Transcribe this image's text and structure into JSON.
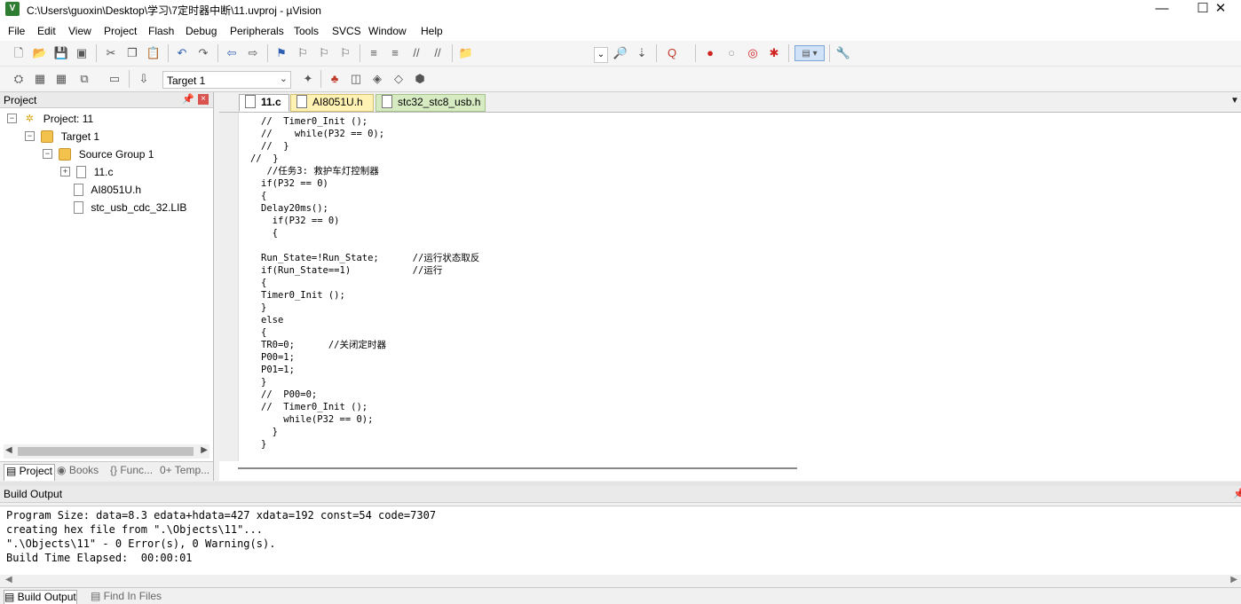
{
  "window": {
    "title": "C:\\Users\\guoxin\\Desktop\\学习\\7定时器中断\\11.uvproj - µVision",
    "controls": {
      "minimize": "—",
      "maximize": "☐",
      "close": "✕"
    }
  },
  "menu": [
    "File",
    "Edit",
    "View",
    "Project",
    "Flash",
    "Debug",
    "Peripherals",
    "Tools",
    "SVCS",
    "Window",
    "Help"
  ],
  "toolbar": {
    "target_value": "Target 1",
    "icons": [
      "new-file",
      "open-file",
      "save",
      "save-all",
      "cut",
      "copy",
      "paste",
      "undo",
      "redo",
      "navigate-back",
      "navigate-forward",
      "bookmark",
      "prev-bookmark",
      "next-bookmark",
      "clear-bookmarks",
      "indent",
      "unindent",
      "comment",
      "uncomment",
      "find-in-files",
      "find",
      "debug-start",
      "breakpoint",
      "disable-breakpoint",
      "kill-breakpoints",
      "window-layout",
      "configure"
    ]
  },
  "project_panel": {
    "title": "Project",
    "tree": {
      "project": "Project: 11",
      "target": "Target 1",
      "group": "Source Group 1",
      "files": [
        "11.c",
        "AI8051U.h",
        "stc_usb_cdc_32.LIB"
      ]
    },
    "tabs": [
      "Project",
      "Books",
      "{} Func...",
      "0+ Temp..."
    ]
  },
  "editor": {
    "tabs": [
      "11.c",
      "AI8051U.h",
      "stc32_stc8_usb.h"
    ],
    "lines": [
      "//  Timer0_Init ();",
      "//    while(P32 == 0);",
      "//  }",
      "//  }",
      "  //任务3: 救护车灯控制器",
      "if(P32 == 0)",
      "{",
      "Delay20ms();",
      "  if(P32 == 0)",
      "  {",
      "",
      "Run_State=!Run_State;      //运行状态取反",
      "if(Run_State==1)           //运行",
      "{",
      "Timer0_Init ();",
      "}",
      "else",
      "{",
      "TR0=0;      //关闭定时器",
      "P00=1;",
      "P01=1;",
      "}",
      "//  P00=0;",
      "//  Timer0_Init ();",
      "    while(P32 == 0);",
      "  }",
      "}"
    ]
  },
  "build_output": {
    "title": "Build Output",
    "lines": [
      "Program Size: data=8.3 edata+hdata=427 xdata=192 const=54 code=7307",
      "creating hex file from \".\\Objects\\11\"...",
      "\".\\Objects\\11\" - 0 Error(s), 0 Warning(s).",
      "Build Time Elapsed:  00:00:01"
    ],
    "bottom_tabs": [
      "Build Output",
      "Find In Files"
    ]
  }
}
